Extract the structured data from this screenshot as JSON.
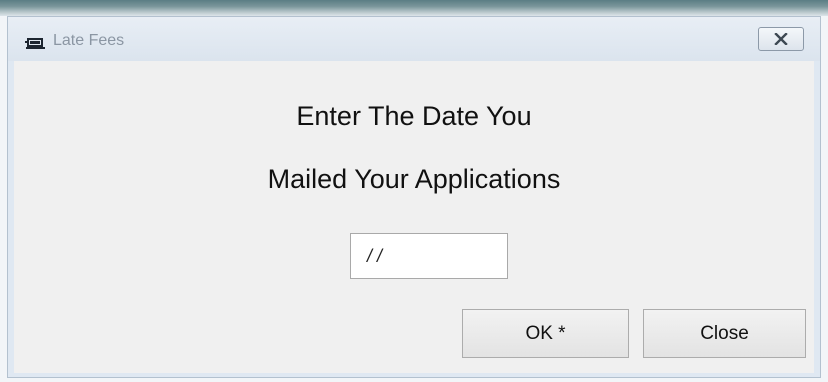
{
  "window": {
    "title": "Late Fees"
  },
  "icons": {
    "app": "car-icon",
    "close": "close-icon"
  },
  "prompt": {
    "line1": "Enter The Date You",
    "line2": "Mailed Your Applications"
  },
  "date_field": {
    "value": " / /"
  },
  "buttons": {
    "ok_label": "OK *",
    "close_label": "Close"
  }
}
